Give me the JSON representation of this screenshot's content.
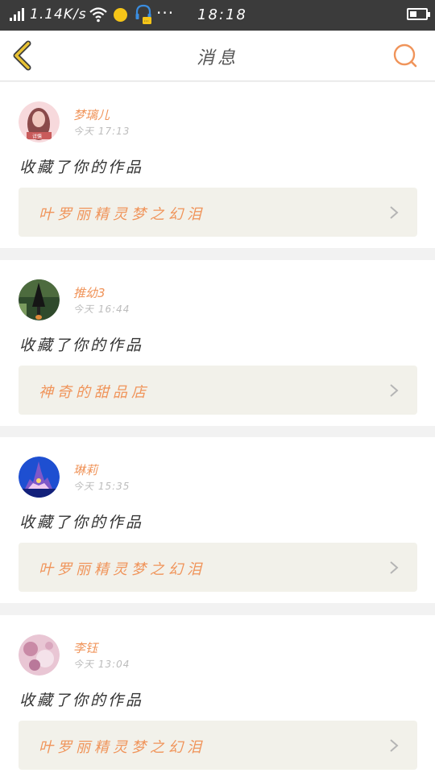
{
  "status_bar": {
    "speed": "1.14K/s",
    "time": "18:18",
    "more": "···",
    "battery_level": 0.45,
    "icons": [
      "signal-icon",
      "wifi-icon",
      "notification-dot-icon",
      "headset-icon",
      "battery-icon"
    ]
  },
  "header": {
    "title": "消息",
    "back_icon": "chevron-left-icon",
    "search_icon": "search-icon",
    "accent": "#f0945a",
    "back_color": "#e8c233"
  },
  "messages": [
    {
      "username": "梦璃儿",
      "time": "今天 17:13",
      "action": "收藏了你的作品",
      "work": "叶罗丽精灵梦之幻泪",
      "avatar_label": "详情",
      "avatar_colors": [
        "#f7d9dc",
        "#c95b5b",
        "#e8a9a9"
      ]
    },
    {
      "username": "推幼3",
      "time": "今天 16:44",
      "action": "收藏了你的作品",
      "work": "神奇的甜品店",
      "avatar_colors": [
        "#2f4a2c",
        "#1a1a1a",
        "#7a9a5e"
      ]
    },
    {
      "username": "琳莉",
      "time": "今天 15:35",
      "action": "收藏了你的作品",
      "work": "叶罗丽精灵梦之幻泪",
      "avatar_colors": [
        "#1e4fd1",
        "#7e58c9",
        "#f0c8f0"
      ]
    },
    {
      "username": "李钰",
      "time": "今天 13:04",
      "action": "收藏了你的作品",
      "work": "叶罗丽精灵梦之幻泪",
      "avatar_colors": [
        "#e9c6d4",
        "#c98aa6",
        "#f4e2ea"
      ]
    }
  ]
}
